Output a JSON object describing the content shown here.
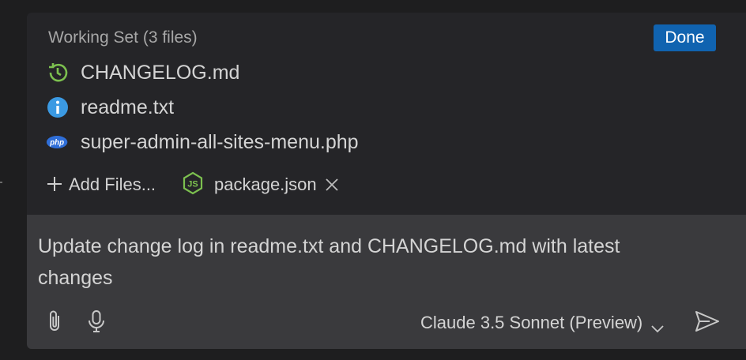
{
  "working_set": {
    "title": "Working Set (3 files)",
    "done_label": "Done",
    "files": [
      {
        "name": "CHANGELOG.md",
        "icon": "history-icon",
        "color": "#7cc04f"
      },
      {
        "name": "readme.txt",
        "icon": "info-icon",
        "color": "#3b9ae3"
      },
      {
        "name": "super-admin-all-sites-menu.php",
        "icon": "php-icon",
        "color": "#2f6ed8"
      }
    ],
    "add_files_label": "Add Files...",
    "attached_chip": {
      "name": "package.json",
      "icon": "nodejs-icon",
      "color": "#7cc04f"
    }
  },
  "chat": {
    "prompt_text": "Update change log in readme.txt and CHANGELOG.md with latest changes",
    "model_label": "Claude 3.5 Sonnet (Preview)"
  },
  "colors": {
    "background": "#1e1e1f",
    "panel": "#252528",
    "input": "#3a3a3d",
    "accent": "#1063b0"
  }
}
